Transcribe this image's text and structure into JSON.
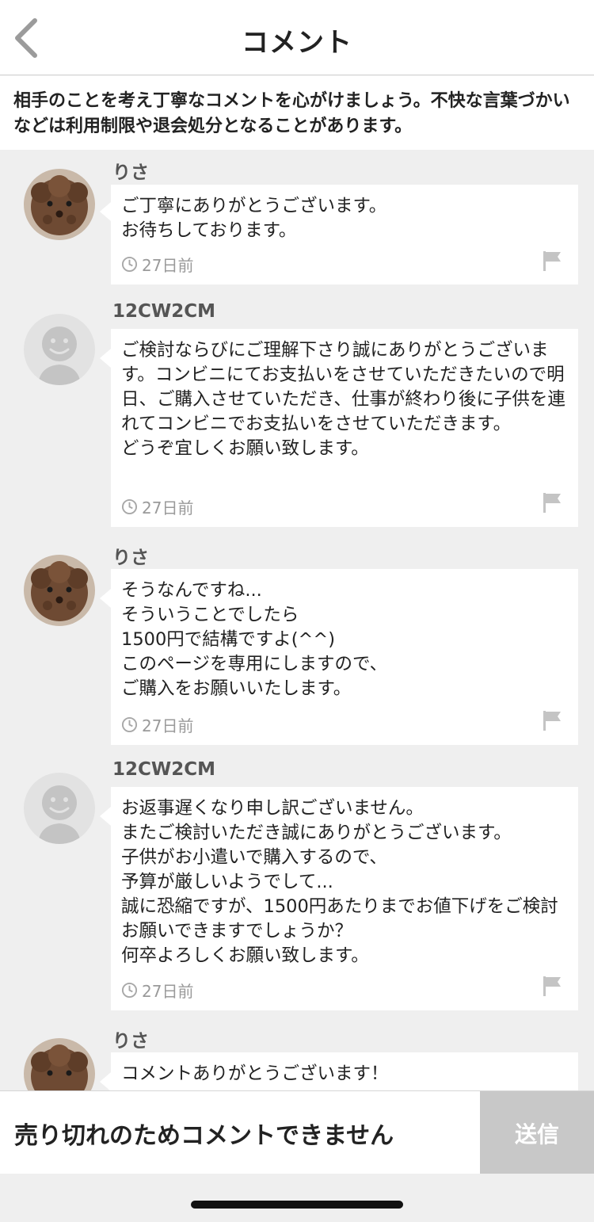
{
  "header": {
    "title": "コメント",
    "back_icon": "chevron-left-icon"
  },
  "notice": {
    "text": "相手のことを考え丁寧なコメントを心がけましょう。不快な言葉づかいなどは利用制限や退会処分となることがあります。"
  },
  "comments": [
    {
      "username": "りさ",
      "avatar": "poodle-photo",
      "text": "ご丁寧にありがとうございます。\nお待ちしております。",
      "time": "27日前"
    },
    {
      "username": "12CW2CM",
      "avatar": "default-user-icon",
      "text": "ご検討ならびにご理解下さり誠にありがとうございます。コンビニにてお支払いをさせていただきたいので明日、ご購入させていただき、仕事が終わり後に子供を連れてコンビニでお支払いをさせていただきます。\nどうぞ宜しくお願い致します。",
      "time": "27日前"
    },
    {
      "username": "りさ",
      "avatar": "poodle-photo",
      "text": "そうなんですね...\nそういうことでしたら\n1500円で結構ですよ(^^)\nこのページを専用にしますので、\nご購入をお願いいたします。",
      "time": "27日前"
    },
    {
      "username": "12CW2CM",
      "avatar": "default-user-icon",
      "text": "お返事遅くなり申し訳ございません。\nまたご検討いただき誠にありがとうございます。\n子供がお小遣いで購入するので、\n予算が厳しいようでして...\n誠に恐縮ですが、1500円あたりまでお値下げをご検討お願いできますでしょうか？\n何卒よろしくお願い致します。",
      "time": "27日前"
    },
    {
      "username": "りさ",
      "avatar": "poodle-photo",
      "text": "コメントありがとうございます！",
      "time": ""
    }
  ],
  "bottom_bar": {
    "message": "売り切れのためコメントできません",
    "send_label": "送信"
  },
  "colors": {
    "background": "#efefef",
    "bubble": "#ffffff",
    "send_disabled": "#c8c8c8",
    "muted_text": "#9a9a9a"
  }
}
